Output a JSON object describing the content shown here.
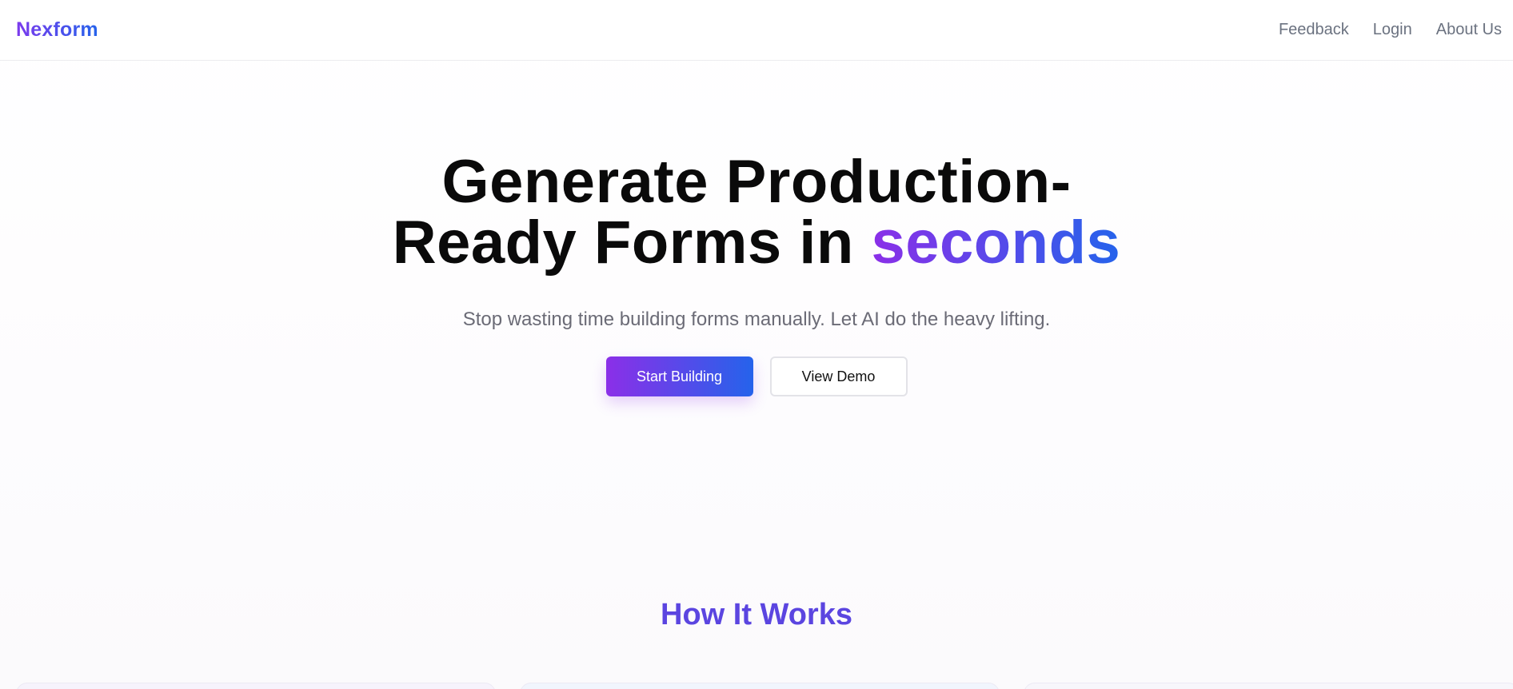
{
  "header": {
    "logo": "Nexform",
    "nav": [
      {
        "label": "Feedback"
      },
      {
        "label": "Login"
      },
      {
        "label": "About Us"
      }
    ]
  },
  "hero": {
    "title_line1": "Generate Production-",
    "title_line2_prefix": "Ready Forms in ",
    "title_accent": "seconds",
    "subtitle": "Stop wasting time building forms manually. Let AI do the heavy lifting.",
    "primary_button": "Start Building",
    "secondary_button": "View Demo"
  },
  "how_it_works": {
    "title": "How It Works"
  },
  "colors": {
    "brand_gradient_start": "#8b2fe8",
    "brand_gradient_end": "#2563eb",
    "section_title": "#5b45e0",
    "muted_text": "#6b7280"
  }
}
